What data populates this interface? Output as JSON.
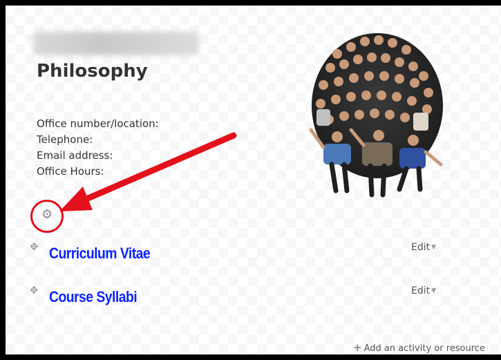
{
  "section": {
    "title": "Philosophy",
    "info_lines": [
      "Office number/location:",
      "Telephone:",
      "Email address:",
      "Office Hours:"
    ]
  },
  "icons": {
    "settings": "gear-icon",
    "move": "move-arrows-icon",
    "add": "plus-icon"
  },
  "activities": [
    {
      "title": "Curriculum Vitae",
      "edit_label": "Edit"
    },
    {
      "title": "Course Syllabi",
      "edit_label": "Edit"
    }
  ],
  "footer": {
    "add_label": "Add an activity or resource"
  },
  "colors": {
    "link": "#0b24ff",
    "annotation": "#e3111b",
    "frame": "#000000"
  }
}
